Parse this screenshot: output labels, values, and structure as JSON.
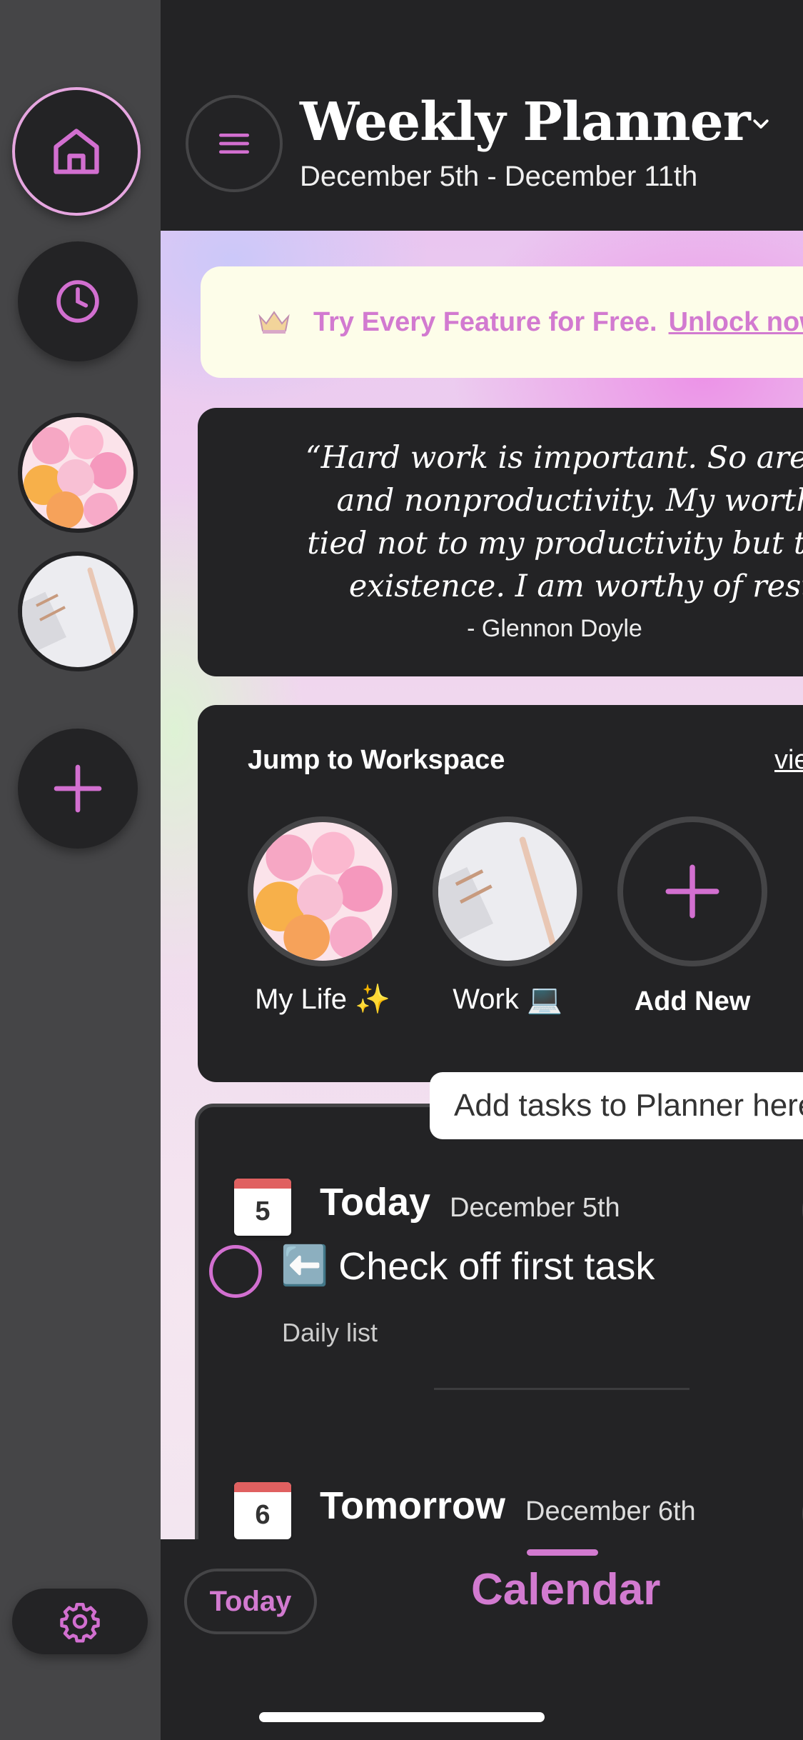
{
  "sidebar": {
    "items": [
      {
        "icon": "home-icon"
      },
      {
        "icon": "clock-icon"
      },
      {
        "icon": "workspace-photo-balloons"
      },
      {
        "icon": "workspace-photo-desk"
      },
      {
        "icon": "plus-icon"
      },
      {
        "icon": "gear-icon"
      }
    ]
  },
  "header": {
    "title": "Weekly Planner",
    "date_range": "December 5th - December 11th"
  },
  "promo": {
    "text": "Try Every Feature for Free.",
    "link": "Unlock now"
  },
  "quote": {
    "lines": "“Hard work is important. So are play\nand nonproductivity. My worth is\ntied not to my productivity but to my\nexistence. I am worthy of rest.”",
    "author": "- Glennon Doyle"
  },
  "workspace": {
    "title": "Jump to Workspace",
    "view_all": "view all",
    "items": [
      {
        "label": "My Life ✨"
      },
      {
        "label": "Work 💻"
      },
      {
        "label": "Add New"
      }
    ]
  },
  "tooltip": "Add tasks to Planner here",
  "days": [
    {
      "icon_num": "5",
      "name": "Today",
      "date": "December 5th"
    },
    {
      "icon_num": "6",
      "name": "Tomorrow",
      "date": "December 6th"
    }
  ],
  "task": {
    "emoji": "⬅️",
    "title": "Check off first task",
    "list": "Daily list"
  },
  "bottom_bar": {
    "today_label": "Today",
    "calendar_label": "Calendar"
  },
  "colors": {
    "accent": "#d27ad0",
    "background": "#232325",
    "sidebar": "#454547"
  }
}
